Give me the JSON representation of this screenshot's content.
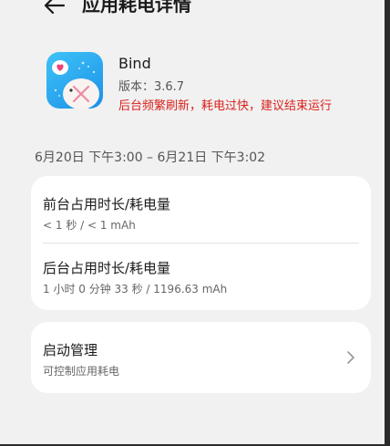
{
  "header": {
    "title": "应用耗电详情"
  },
  "app": {
    "name": "Bind",
    "version": "版本：3.6.7",
    "warning": "后台频繁刷新，耗电过快，建议结束运行"
  },
  "date_range": "6月20日 下午3:00 – 6月21日 下午3:02",
  "usage": {
    "foreground": {
      "title": "前台占用时长/耗电量",
      "value": "< 1 秒 / < 1 mAh"
    },
    "background": {
      "title": "后台占用时长/耗电量",
      "value": "1 小时 0 分钟 33 秒 / 1196.63 mAh"
    }
  },
  "startup": {
    "title": "启动管理",
    "subtitle": "可控制应用耗电"
  },
  "colors": {
    "warning": "#d9211c",
    "icon_bg": "#2aa9f0",
    "background": "#f1f1f1"
  },
  "icons": {
    "back": "back-arrow-icon",
    "chevron": "chevron-right-icon"
  }
}
